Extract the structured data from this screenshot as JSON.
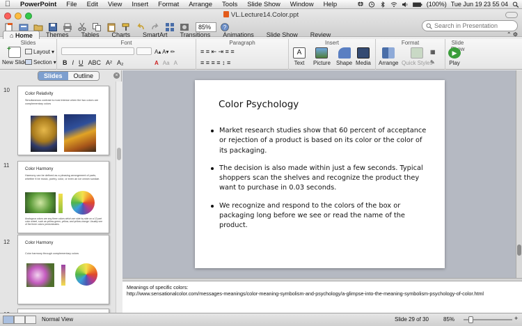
{
  "menubar": {
    "app_name": "PowerPoint",
    "items": [
      "File",
      "Edit",
      "View",
      "Insert",
      "Format",
      "Arrange",
      "Tools",
      "Slide Show",
      "Window",
      "Help"
    ],
    "battery": "(100%)",
    "clock": "Tue Jun 19  23 55 04"
  },
  "window": {
    "title": "VL.Lecture14.Color.ppt"
  },
  "toolbar": {
    "zoom": "85%",
    "search_placeholder": "Search in Presentation"
  },
  "ribbon_tabs": [
    "Home",
    "Themes",
    "Tables",
    "Charts",
    "SmartArt",
    "Transitions",
    "Animations",
    "Slide Show",
    "Review"
  ],
  "ribbon": {
    "groups": {
      "slides": "Slides",
      "font": "Font",
      "paragraph": "Paragraph",
      "insert": "Insert",
      "format": "Format",
      "slide_show": "Slide Show"
    },
    "new_slide": "New Slide",
    "layout": "Layout",
    "section": "Section",
    "text": "Text",
    "picture": "Picture",
    "shape": "Shape",
    "media": "Media",
    "arrange": "Arrange",
    "quick_styles": "Quick Styles",
    "play": "Play"
  },
  "left_pane": {
    "tabs": [
      "Slides",
      "Outline"
    ],
    "thumbnails": [
      {
        "num": "10",
        "title": "Color Relativity",
        "text": "Simultaneous contrast is most intense when the two colors are complementary colors"
      },
      {
        "num": "11",
        "title": "Color Harmony",
        "text": "Harmony can be defined as a pleasing arrangement of parts, whether it be music, poetry, color, or even an ice cream sundae.",
        "text2": "Analogous colors are any three colors which are side by side on a 12 part color wheel, such as yellow-green, yellow, and yellow-orange. Usually one of the three colors predominates."
      },
      {
        "num": "12",
        "title": "Color Harmony",
        "text": "Color harmony through complementary colors"
      }
    ]
  },
  "slide": {
    "title": "Color Psychology",
    "bullets": [
      "Market research studies show that 60 percent of acceptance or rejection of a product is based on its color or the color of its packaging.",
      "The decision is also made within just a few seconds. Typical shoppers scan the shelves and recognize the product they want to purchase in 0.03 seconds.",
      "We recognize and respond to the colors of the box or packaging long before we see or read the name of the product."
    ]
  },
  "notes": {
    "line1": "Meanings of specific colors:",
    "line2": "http://www.sensationalcolor.com/messages-meanings/color-meaning-symbolism-and-psychology/a-glimpse-into-the-meaning-symbolism-psychology-of-color.html"
  },
  "status": {
    "view": "Normal View",
    "slide_info": "Slide 29 of 30",
    "zoom": "85%"
  }
}
